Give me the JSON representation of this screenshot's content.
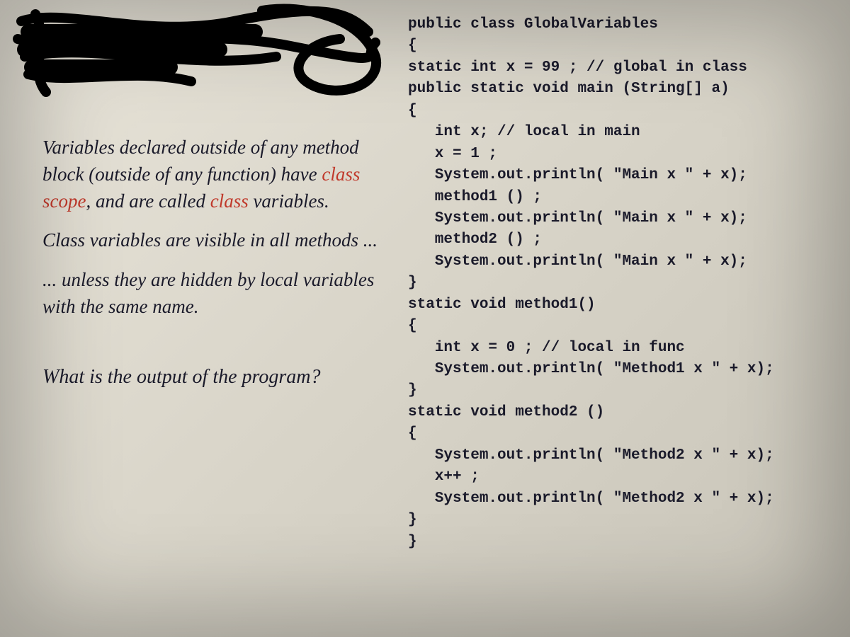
{
  "explain": {
    "p1_a": "Variables declared outside of any method block (outside of any function) have ",
    "p1_red1": "class scope",
    "p1_b": ", and are called ",
    "p1_red2": "class",
    "p1_c": " variables.",
    "p2": "Class variables are visible in all methods ...",
    "p3": "... unless they are hidden by local variables with the same name."
  },
  "question": "What is the output of the program?",
  "code": {
    "l01": "public class GlobalVariables",
    "l02": "{",
    "l03": "static int x = 99 ; // global in class",
    "l04": "",
    "l05": "public static void main (String[] a)",
    "l06": "{",
    "l07": "   int x; // local in main",
    "l08": "",
    "l09": "   x = 1 ;",
    "l10": "   System.out.println( \"Main x \" + x);",
    "l11": "   method1 () ;",
    "l12": "   System.out.println( \"Main x \" + x);",
    "l13": "   method2 () ;",
    "l14": "   System.out.println( \"Main x \" + x);",
    "l15": "}",
    "l16": "",
    "l17": "static void method1()",
    "l18": "{",
    "l19": "   int x = 0 ; // local in func",
    "l20": "   System.out.println( \"Method1 x \" + x);",
    "l21": "}",
    "l22": "",
    "l23": "static void method2 ()",
    "l24": "{",
    "l25": "   System.out.println( \"Method2 x \" + x);",
    "l26": "   x++ ;",
    "l27": "   System.out.println( \"Method2 x \" + x);",
    "l28": "}",
    "l29": "",
    "l30": "}"
  }
}
